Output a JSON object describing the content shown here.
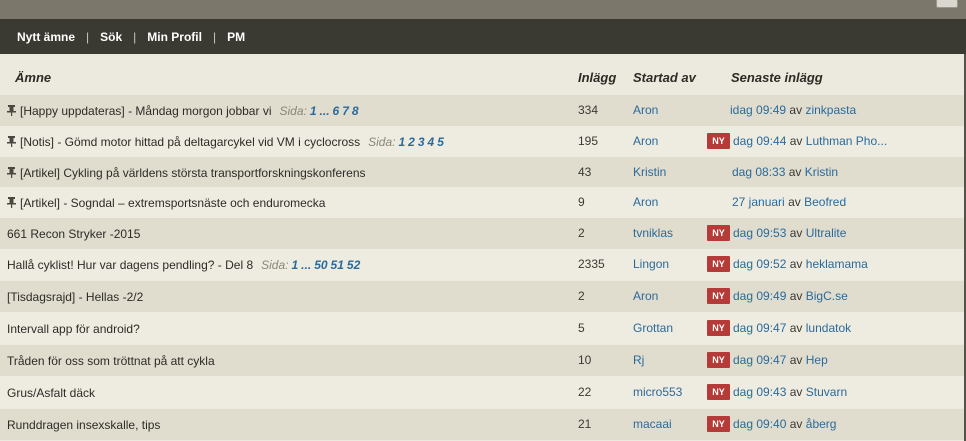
{
  "nav": {
    "items": [
      "Nytt ämne",
      "Sök",
      "Min Profil",
      "PM"
    ],
    "separator": "|"
  },
  "table": {
    "headers": {
      "subject": "Ämne",
      "posts": "Inlägg",
      "started_by": "Startad av",
      "latest": "Senaste inlägg"
    },
    "by_word": "av",
    "new_badge": "NY",
    "pages_label": "Sida:",
    "rows": [
      {
        "pinned": true,
        "title": "[Happy uppdateras] - Måndag morgon jobbar vi",
        "pages": [
          "1",
          "...",
          "6",
          "7",
          "8"
        ],
        "posts": "334",
        "starter": "Aron",
        "is_new": false,
        "latest_time": "idag 09:49",
        "latest_user": "zinkpasta"
      },
      {
        "pinned": true,
        "title": "[Notis] - Gömd motor hittad på deltagarcykel vid VM i cyclocross",
        "pages": [
          "1",
          "2",
          "3",
          "4",
          "5"
        ],
        "posts": "195",
        "starter": "Aron",
        "is_new": true,
        "latest_time": "dag 09:44",
        "latest_user": "Luthman Pho..."
      },
      {
        "pinned": true,
        "title": "[Artikel] Cykling på världens största transportforskningskonferens",
        "pages": [],
        "posts": "43",
        "starter": "Kristin",
        "is_new": false,
        "latest_time": "dag 08:33",
        "latest_user": "Kristin"
      },
      {
        "pinned": true,
        "title": "[Artikel] - Sogndal – extremsportsnäste och enduromecka",
        "pages": [],
        "posts": "9",
        "starter": "Aron",
        "is_new": false,
        "latest_time": "27 januari",
        "latest_user": "Beofred"
      },
      {
        "pinned": false,
        "title": "661 Recon Stryker -2015",
        "pages": [],
        "posts": "2",
        "starter": "tvniklas",
        "is_new": true,
        "latest_time": "dag 09:53",
        "latest_user": "Ultralite"
      },
      {
        "pinned": false,
        "title": "Hallå cyklist! Hur var dagens pendling? - Del 8",
        "pages": [
          "1",
          "...",
          "50",
          "51",
          "52"
        ],
        "posts": "2335",
        "starter": "Lingon",
        "is_new": true,
        "latest_time": "dag 09:52",
        "latest_user": "heklamama"
      },
      {
        "pinned": false,
        "title": "[Tisdagsrajd] - Hellas -2/2",
        "pages": [],
        "posts": "2",
        "starter": "Aron",
        "is_new": true,
        "latest_time": "dag 09:49",
        "latest_user": "BigC.se"
      },
      {
        "pinned": false,
        "title": "Intervall app för android?",
        "pages": [],
        "posts": "5",
        "starter": "Grottan",
        "is_new": true,
        "latest_time": "dag 09:47",
        "latest_user": "lundatok"
      },
      {
        "pinned": false,
        "title": "Tråden för oss som tröttnat på att cykla",
        "pages": [],
        "posts": "10",
        "starter": "Rj",
        "is_new": true,
        "latest_time": "dag 09:47",
        "latest_user": "Hep"
      },
      {
        "pinned": false,
        "title": "Grus/Asfalt däck",
        "pages": [],
        "posts": "22",
        "starter": "micro553",
        "is_new": true,
        "latest_time": "dag 09:43",
        "latest_user": "Stuvarn"
      },
      {
        "pinned": false,
        "title": "Runddragen insexskalle, tips",
        "pages": [],
        "posts": "21",
        "starter": "macaai",
        "is_new": true,
        "latest_time": "dag 09:40",
        "latest_user": "åberg"
      }
    ]
  },
  "colors": {
    "nav_bg": "#3b3a32",
    "row_odd": "#e0ddcf",
    "row_even": "#eeece1",
    "link": "#2a6a9b",
    "badge": "#b43b37"
  }
}
